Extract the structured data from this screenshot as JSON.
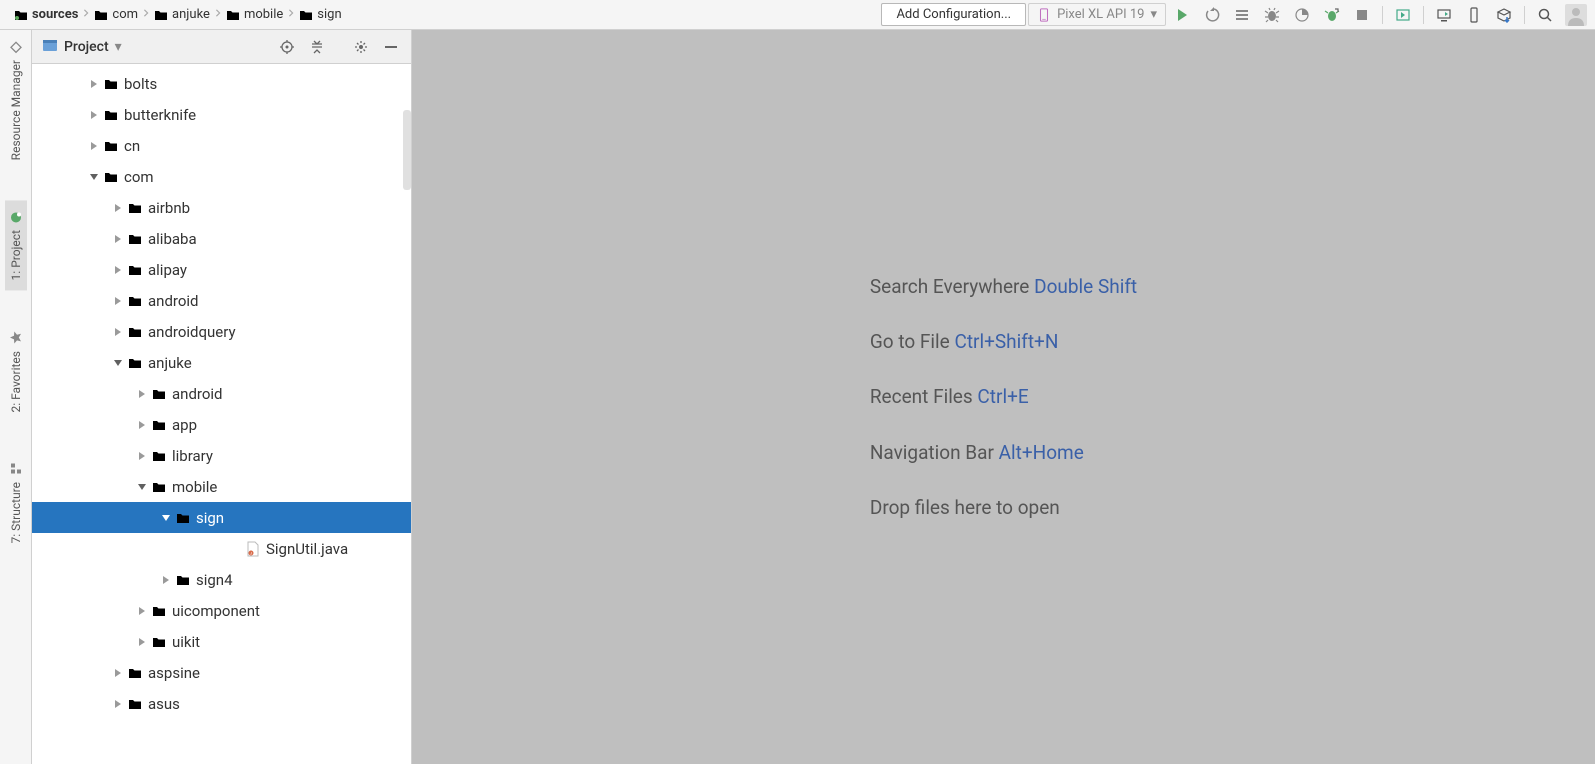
{
  "breadcrumbs": [
    {
      "label": "sources",
      "icon": "src",
      "bold": true
    },
    {
      "label": "com",
      "icon": "grey"
    },
    {
      "label": "anjuke",
      "icon": "grey"
    },
    {
      "label": "mobile",
      "icon": "grey"
    },
    {
      "label": "sign",
      "icon": "grey"
    }
  ],
  "toolbar": {
    "config_label": "Add Configuration...",
    "device_label": "Pixel XL API 19"
  },
  "sidebar": {
    "title": "Project"
  },
  "tree": [
    {
      "label": "bolts",
      "indent": 1,
      "state": "collapsed",
      "type": "folder"
    },
    {
      "label": "butterknife",
      "indent": 1,
      "state": "collapsed",
      "type": "folder"
    },
    {
      "label": "cn",
      "indent": 1,
      "state": "collapsed",
      "type": "folder"
    },
    {
      "label": "com",
      "indent": 1,
      "state": "expanded",
      "type": "folder"
    },
    {
      "label": "airbnb",
      "indent": 2,
      "state": "collapsed",
      "type": "folder"
    },
    {
      "label": "alibaba",
      "indent": 2,
      "state": "collapsed",
      "type": "folder"
    },
    {
      "label": "alipay",
      "indent": 2,
      "state": "collapsed",
      "type": "folder"
    },
    {
      "label": "android",
      "indent": 2,
      "state": "collapsed",
      "type": "folder"
    },
    {
      "label": "androidquery",
      "indent": 2,
      "state": "collapsed",
      "type": "folder"
    },
    {
      "label": "anjuke",
      "indent": 2,
      "state": "expanded",
      "type": "folder"
    },
    {
      "label": "android",
      "indent": 3,
      "state": "collapsed",
      "type": "folder"
    },
    {
      "label": "app",
      "indent": 3,
      "state": "collapsed",
      "type": "folder"
    },
    {
      "label": "library",
      "indent": 3,
      "state": "collapsed",
      "type": "folder"
    },
    {
      "label": "mobile",
      "indent": 3,
      "state": "expanded",
      "type": "folder"
    },
    {
      "label": "sign",
      "indent": 4,
      "state": "expanded",
      "type": "folder",
      "selected": true
    },
    {
      "label": "SignUtil.java",
      "indent": 6,
      "state": "none",
      "type": "file"
    },
    {
      "label": "sign4",
      "indent": 4,
      "state": "collapsed",
      "type": "folder"
    },
    {
      "label": "uicomponent",
      "indent": 3,
      "state": "collapsed",
      "type": "folder"
    },
    {
      "label": "uikit",
      "indent": 3,
      "state": "collapsed",
      "type": "folder"
    },
    {
      "label": "aspsine",
      "indent": 2,
      "state": "collapsed",
      "type": "folder"
    },
    {
      "label": "asus",
      "indent": 2,
      "state": "collapsed",
      "type": "folder"
    }
  ],
  "left_rail": [
    {
      "label": "Resource Manager",
      "icon": "diamond"
    },
    {
      "label": "1: Project",
      "icon": "project",
      "active": true
    },
    {
      "label": "2: Favorites",
      "icon": "star"
    },
    {
      "label": "7: Structure",
      "icon": "structure"
    }
  ],
  "editor_tips": [
    {
      "text": "Search Everywhere",
      "shortcut": "Double Shift"
    },
    {
      "text": "Go to File",
      "shortcut": "Ctrl+Shift+N"
    },
    {
      "text": "Recent Files",
      "shortcut": "Ctrl+E"
    },
    {
      "text": "Navigation Bar",
      "shortcut": "Alt+Home"
    },
    {
      "text": "Drop files here to open",
      "shortcut": ""
    }
  ]
}
